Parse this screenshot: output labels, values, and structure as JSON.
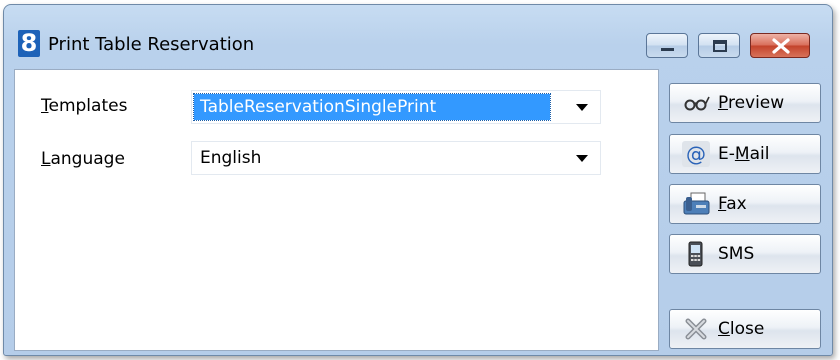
{
  "window": {
    "icon_text": "8",
    "title": "Print Table Reservation"
  },
  "form": {
    "templates": {
      "label_mnemonic": "T",
      "label_rest": "emplates",
      "value": "TableReservationSinglePrint"
    },
    "language": {
      "label_mnemonic": "L",
      "label_rest": "anguage",
      "value": "English"
    }
  },
  "actions": {
    "preview": {
      "pre": "",
      "mnemonic": "P",
      "post": "review"
    },
    "email": {
      "pre": "E-",
      "mnemonic": "M",
      "post": "ail"
    },
    "fax": {
      "pre": "",
      "mnemonic": "F",
      "post": "ax"
    },
    "sms": {
      "pre": "SMS",
      "mnemonic": "",
      "post": ""
    },
    "close": {
      "pre": "",
      "mnemonic": "C",
      "post": "lose"
    }
  },
  "colors": {
    "selection": "#3399ff",
    "window_frame": "#b9d1ec",
    "close_button": "#c3432c"
  },
  "icons": {
    "app": "app-logo-icon",
    "minimize": "minimize-icon",
    "maximize": "maximize-icon",
    "close": "close-icon",
    "preview": "glasses-icon",
    "email": "at-sign-icon",
    "fax": "fax-icon",
    "sms": "mobile-phone-icon",
    "close_action": "close-x-icon"
  }
}
